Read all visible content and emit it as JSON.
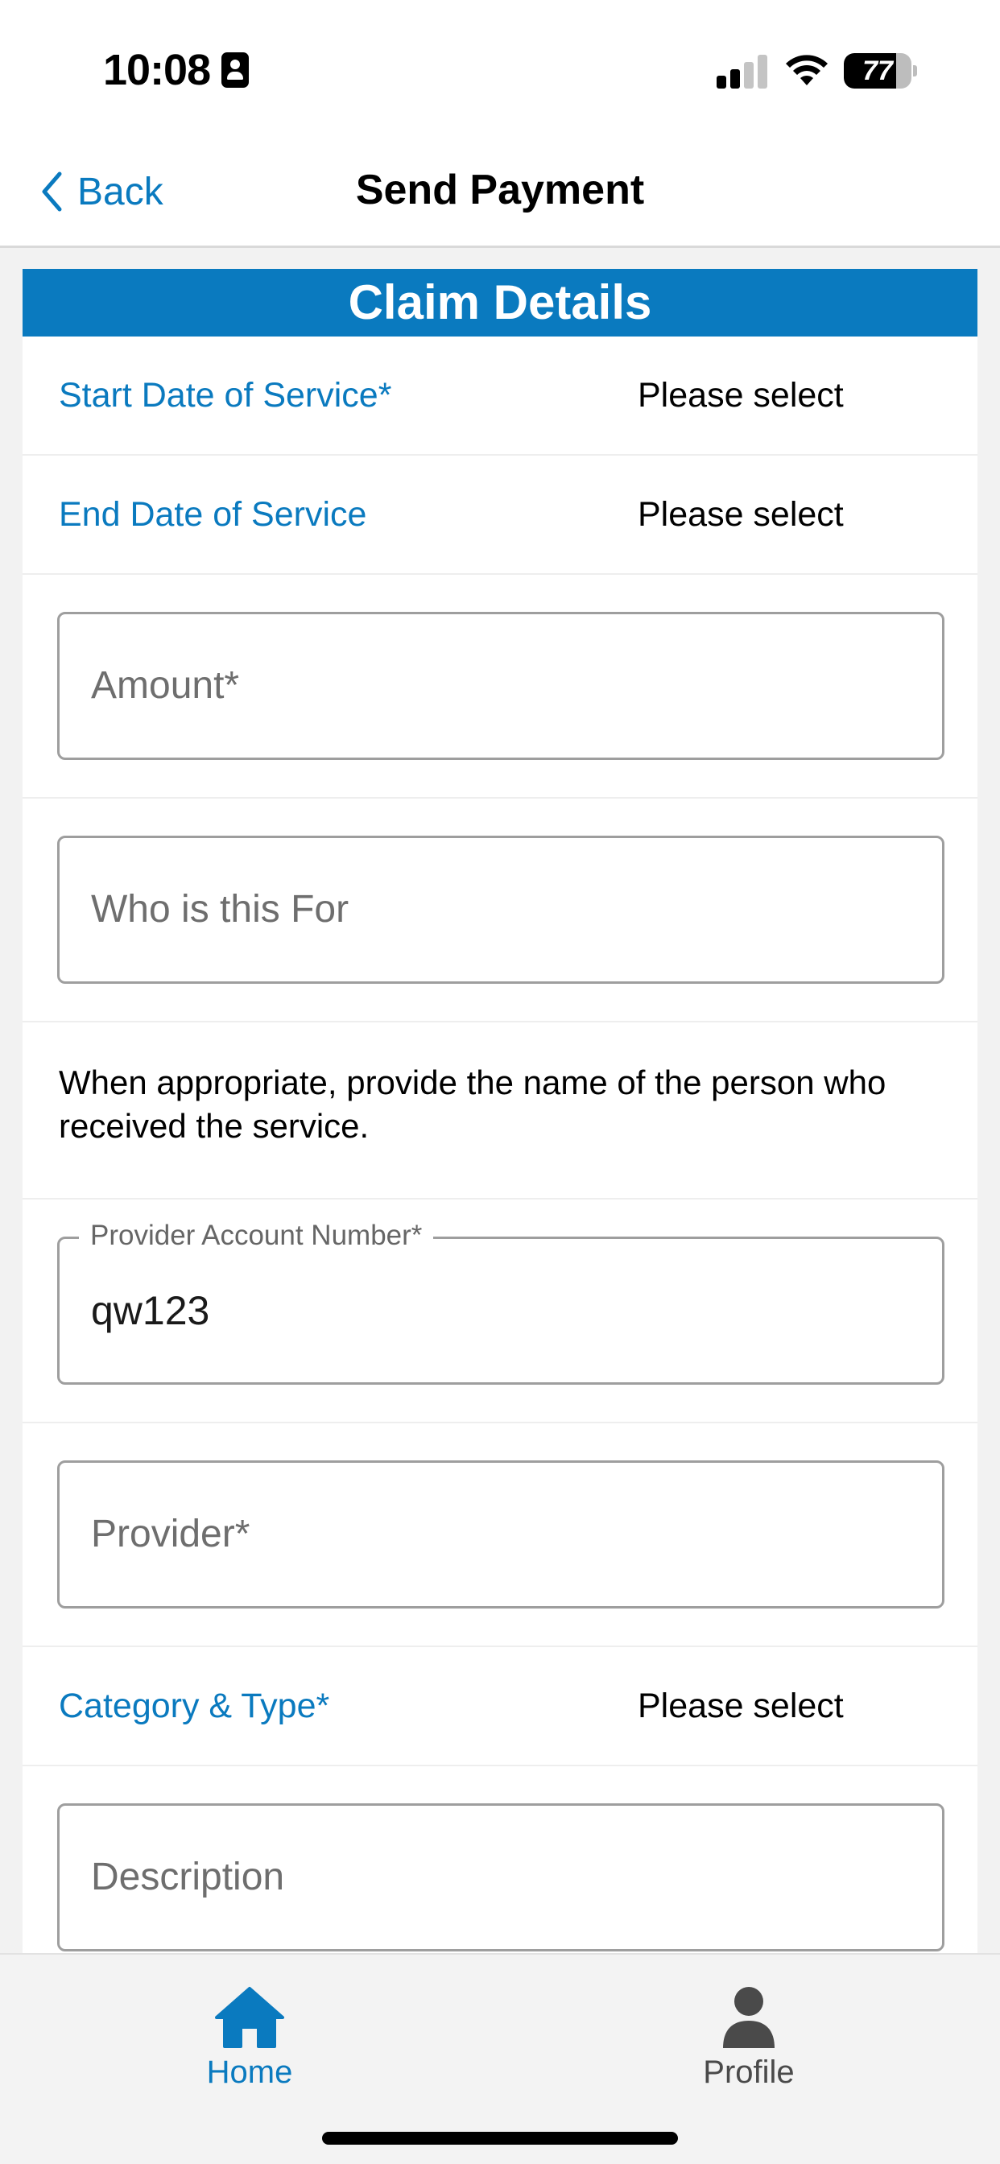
{
  "status_bar": {
    "time": "10:08",
    "battery_level": "77",
    "battery_fraction": 0.77,
    "signal_bars_filled": 2,
    "signal_bars_total": 4
  },
  "nav": {
    "back_label": "Back",
    "title": "Send Payment"
  },
  "card": {
    "header": "Claim Details",
    "start_date": {
      "label": "Start Date of Service*",
      "value": "Please select"
    },
    "end_date": {
      "label": "End Date of Service",
      "value": "Please select"
    },
    "amount": {
      "placeholder": "Amount*"
    },
    "who_for": {
      "placeholder": "Who is this For"
    },
    "help_text": "When appropriate, provide the name of the person who received the service.",
    "provider_account": {
      "label": "Provider Account Number*",
      "value": "qw123"
    },
    "provider": {
      "placeholder": "Provider*"
    },
    "category": {
      "label": "Category & Type*",
      "value": "Please select"
    },
    "description": {
      "placeholder": "Description"
    }
  },
  "tab_bar": {
    "home_label": "Home",
    "profile_label": "Profile",
    "active": "home"
  },
  "colors": {
    "accent": "#0a7abf",
    "inactive": "#4a4a4a"
  },
  "icons": {
    "contact": "person-card-icon",
    "signal": "cellular-signal-icon",
    "wifi": "wifi-icon",
    "battery": "battery-icon",
    "back": "chevron-left-icon",
    "home": "house-icon",
    "profile": "person-icon"
  }
}
